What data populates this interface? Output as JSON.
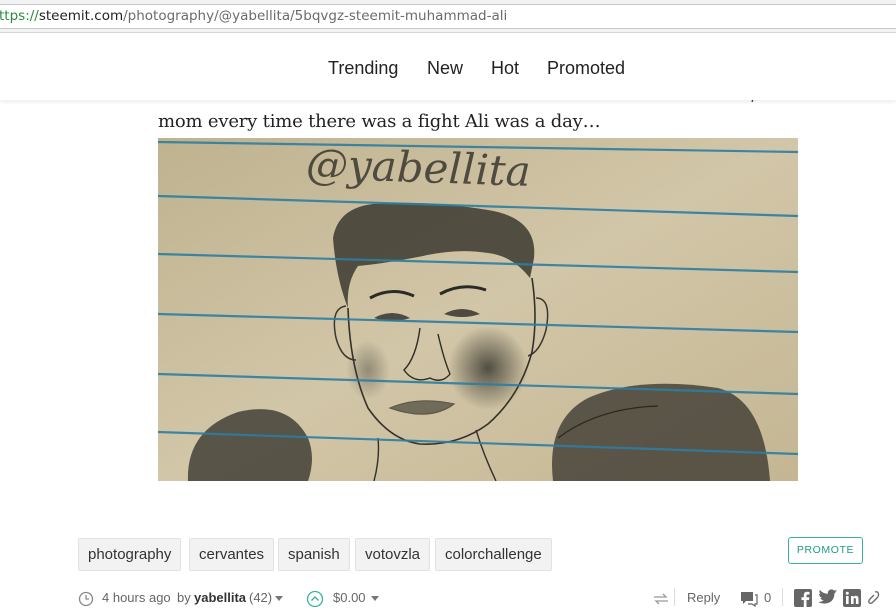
{
  "browser": {
    "url_scheme": "ttps://",
    "url_host": "steemit.com",
    "url_path": "/photography/@yabellita/5bqvgz-steemit-muhammad-ali"
  },
  "nav": {
    "items": [
      "Trending",
      "New",
      "Hot",
      "Promoted"
    ]
  },
  "post": {
    "excerpt_tail": "mom every time there was a fight Ali was a day…",
    "image": {
      "signature_text": "@yabellita"
    },
    "tags": [
      "photography",
      "cervantes",
      "spanish",
      "votovzla",
      "colorchallenge"
    ],
    "promote_label": "PROMOTE",
    "meta": {
      "time_ago": "4 hours ago",
      "by_label": "by",
      "author": "yabellita",
      "reputation": "(42)",
      "payout": "$0.00",
      "reply_label": "Reply",
      "comment_count": "0"
    }
  },
  "colors": {
    "accent": "#1f9c86",
    "paper": "#cdbf9e",
    "ruled_line": "#2d7ea3"
  }
}
